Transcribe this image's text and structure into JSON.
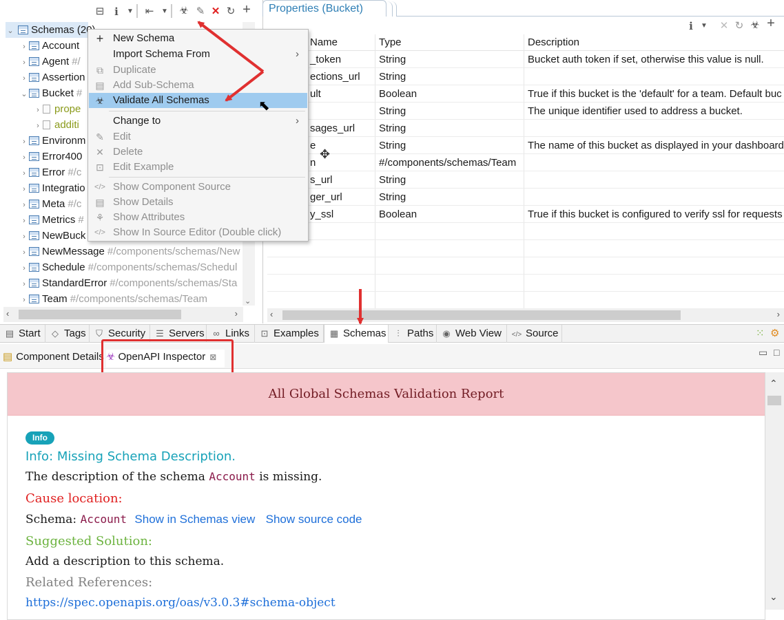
{
  "tree": {
    "root_label": "Schemas (20)",
    "items": [
      {
        "name": "Account",
        "path": ""
      },
      {
        "name": "Agent",
        "path": "#/"
      },
      {
        "name": "Assertion",
        "path": ""
      },
      {
        "name": "Bucket",
        "path": "#"
      },
      {
        "name": "prope",
        "path": ""
      },
      {
        "name": "additi",
        "path": ""
      },
      {
        "name": "Environm",
        "path": ""
      },
      {
        "name": "Error400",
        "path": ""
      },
      {
        "name": "Error",
        "path": "#/c"
      },
      {
        "name": "Integratio",
        "path": ""
      },
      {
        "name": "Meta",
        "path": "#/c"
      },
      {
        "name": "Metrics",
        "path": "#"
      },
      {
        "name": "NewBuck",
        "path": ""
      },
      {
        "name": "NewMessage",
        "path": "#/components/schemas/New"
      },
      {
        "name": "Schedule",
        "path": "#/components/schemas/Schedul"
      },
      {
        "name": "StandardError",
        "path": "#/components/schemas/Sta"
      },
      {
        "name": "Team",
        "path": "#/components/schemas/Team"
      }
    ]
  },
  "properties": {
    "tab_title": "Properties (Bucket)",
    "columns": [
      "Name",
      "Type",
      "Description"
    ],
    "rows": [
      {
        "name": "_token",
        "type": "String",
        "desc": "Bucket auth token if set, otherwise this value is null."
      },
      {
        "name": "ections_url",
        "type": "String",
        "desc": ""
      },
      {
        "name": "ult",
        "type": "Boolean",
        "desc": "True if this bucket is the 'default' for a team. Default buc"
      },
      {
        "name": "",
        "type": "String",
        "desc": "The unique identifier used to address a bucket."
      },
      {
        "name": "sages_url",
        "type": "String",
        "desc": ""
      },
      {
        "name": "e",
        "type": "String",
        "desc": "The name of this bucket as displayed in your dashboard"
      },
      {
        "name": "n",
        "type": "#/components/schemas/Team",
        "desc": ""
      },
      {
        "name": "s_url",
        "type": "String",
        "desc": ""
      },
      {
        "name": "ger_url",
        "type": "String",
        "desc": ""
      },
      {
        "name": "y_ssl",
        "type": "Boolean",
        "desc": "True if this bucket is configured to verify ssl for requests"
      }
    ]
  },
  "context_menu": {
    "new_schema": "New Schema",
    "import_schema": "Import Schema From",
    "duplicate": "Duplicate",
    "add_sub_schema": "Add Sub-Schema",
    "validate_all": "Validate All Schemas",
    "change_to": "Change to",
    "edit": "Edit",
    "delete": "Delete",
    "edit_example": "Edit Example",
    "show_component_source": "Show Component Source",
    "show_details": "Show Details",
    "show_attributes": "Show Attributes",
    "show_in_source": "Show In Source Editor (Double click)"
  },
  "editor_tabs": [
    "Start",
    "Tags",
    "Security",
    "Servers",
    "Links",
    "Examples",
    "Schemas",
    "Paths",
    "Web View",
    "Source"
  ],
  "active_editor_tab": "Schemas",
  "view_tabs": {
    "component_details": "Component Details",
    "openapi_inspector": "OpenAPI Inspector",
    "close_glyph": "⊠"
  },
  "report": {
    "title": "All Global Schemas Validation Report",
    "badge": "Info",
    "issue_title": "Info: Missing Schema Description.",
    "desc_prefix": "The description of the schema",
    "desc_schema": "Account",
    "desc_suffix": "is missing.",
    "cause_heading": "Cause location:",
    "schema_label": "Schema:",
    "schema_name": "Account",
    "link_show_view": "Show in Schemas view",
    "link_show_source": "Show source code",
    "solution_heading": "Suggested Solution:",
    "solution_text": "Add a description to this schema.",
    "refs_heading": "Related References:",
    "ref_url": "https://spec.openapis.org/oas/v3.0.3#schema-object"
  },
  "colors": {
    "accent_blue": "#2f7fb5",
    "menu_highlight": "#9fcbef",
    "report_header_bg": "#f5c6cb",
    "report_header_text": "#721c24",
    "info_badge": "#17a2b8",
    "info_title": "#17a2b8",
    "cause_red": "#e02020",
    "solution_green": "#6cb33f",
    "annotation_red": "#e03030"
  }
}
